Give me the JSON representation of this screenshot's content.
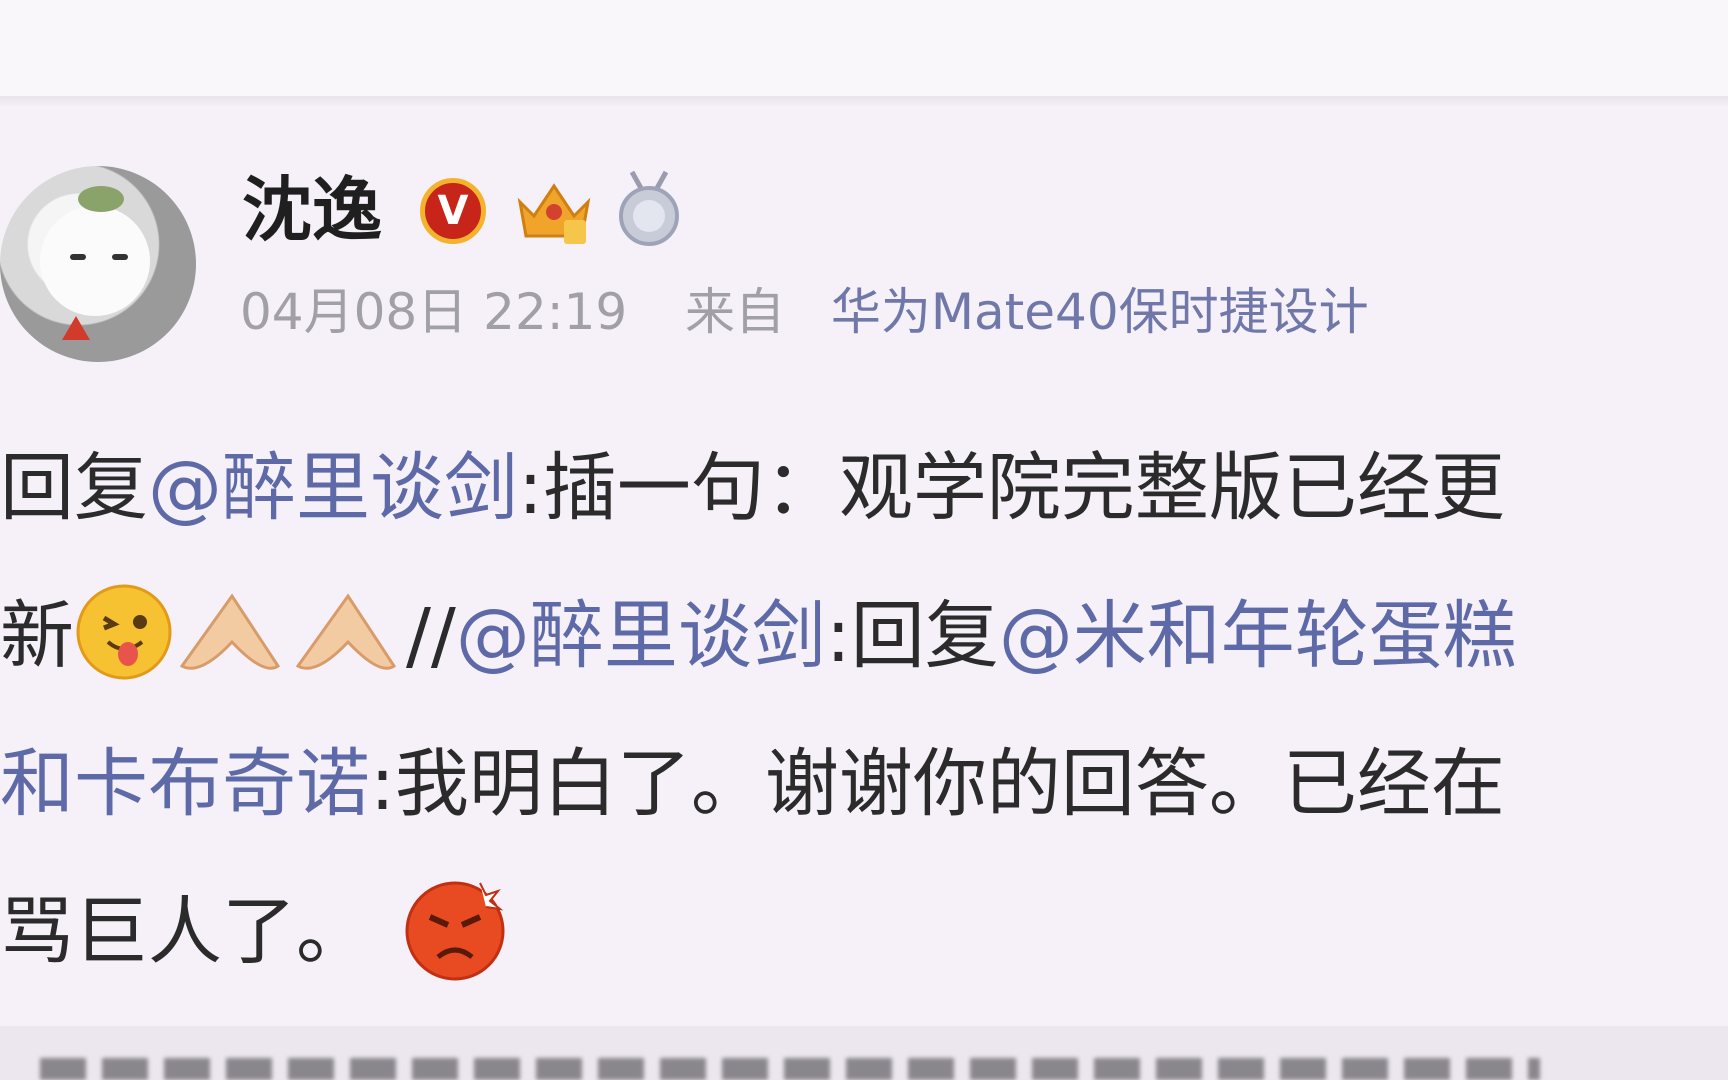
{
  "author": {
    "name": "沈逸",
    "badges": [
      "verified-badge-icon",
      "crown-badge-icon",
      "medal-badge-icon"
    ]
  },
  "meta": {
    "date": "04月08日 22:19",
    "from_label": "来自",
    "source": "华为Mate40保时捷设计"
  },
  "content": {
    "line1": {
      "prefix": "回复",
      "mention": "@醉里谈剑",
      "text": ":插一句：观学院完整版已经更"
    },
    "line2": {
      "prefix": "新",
      "separator": "//",
      "mention1": "@醉里谈剑",
      "reply": ":回复",
      "mention2": "@米和年轮蛋糕"
    },
    "line3": {
      "mention": "和卡布奇诺",
      "text": ":我明白了。谢谢你的回答。已经在"
    },
    "line4": {
      "text": "骂巨人了。"
    }
  },
  "emojis": [
    "tongue-emoji-icon",
    "pray-hands-icon",
    "pray-hands-icon",
    "angry-emoji-icon"
  ],
  "colors": {
    "mention": "#5e6aa8",
    "meta": "#a0a0a6",
    "background": "#f6f1f8"
  }
}
